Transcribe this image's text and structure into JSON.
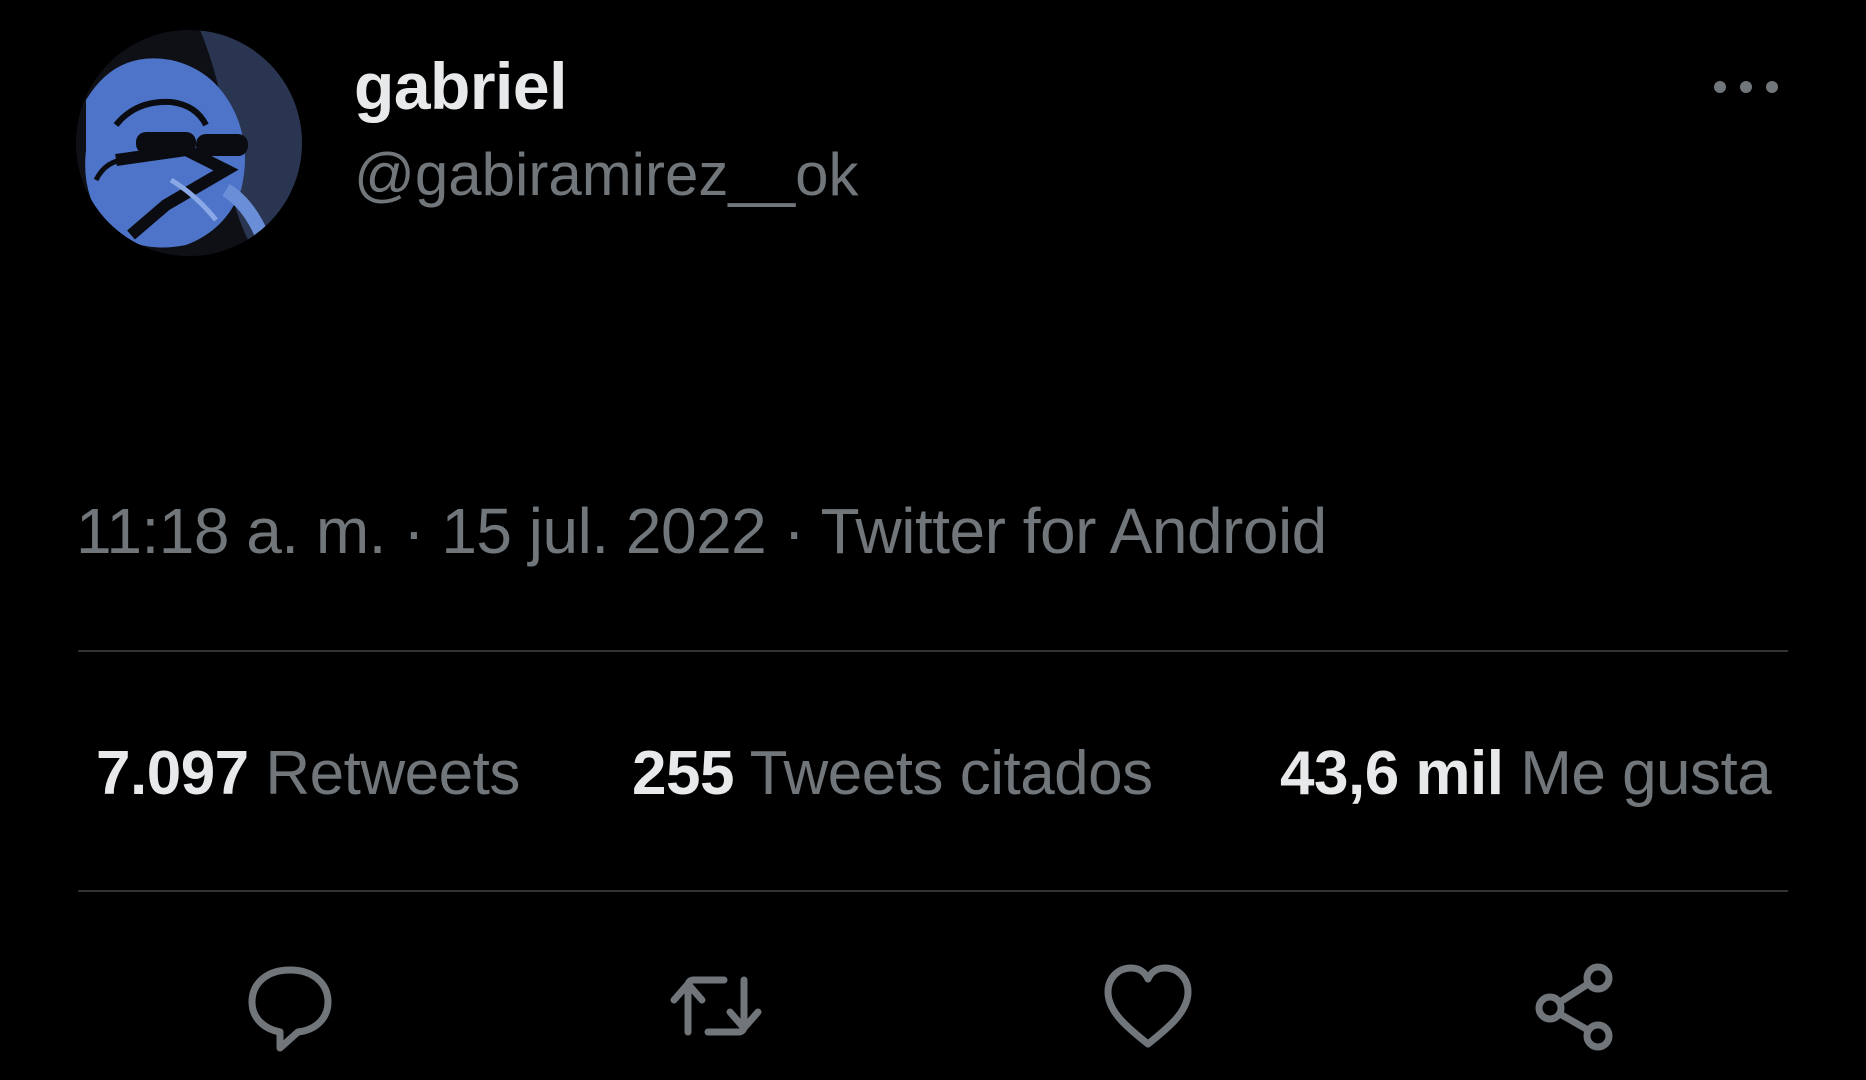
{
  "author": {
    "display_name": "gabriel",
    "handle": "@gabiramirez__ok"
  },
  "tweet": {
    "time": "11:18 a. m.",
    "separator": "·",
    "date": "15 jul. 2022",
    "source": "Twitter for Android"
  },
  "stats": {
    "retweets": {
      "count": "7.097",
      "label": "Retweets"
    },
    "quotes": {
      "count": "255",
      "label": "Tweets citados"
    },
    "likes": {
      "count": "43,6 mil",
      "label": "Me gusta"
    }
  },
  "icons": {
    "more": "more-horizontal-icon",
    "reply": "reply-bubble-icon",
    "retweet": "retweet-icon",
    "like": "heart-icon",
    "share": "share-icon"
  },
  "colors": {
    "background": "#000000",
    "primary_text": "#e7e9ea",
    "secondary_text": "#71767b",
    "divider": "#2f3336",
    "avatar_accent": "#4d74c8"
  }
}
